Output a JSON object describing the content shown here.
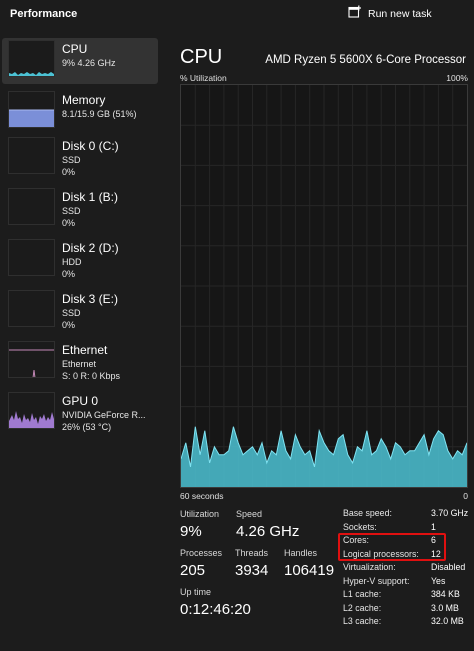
{
  "header": {
    "title": "Performance",
    "run_new_task_label": "Run new task"
  },
  "sidebar": {
    "items": [
      {
        "name": "CPU",
        "sub1": "9% 4.26 GHz",
        "sub2": "",
        "color": "#4cc2d4"
      },
      {
        "name": "Memory",
        "sub1": "8.1/15.9 GB (51%)",
        "sub2": "",
        "color": "#7b8fd8"
      },
      {
        "name": "Disk 0 (C:)",
        "sub1": "SSD",
        "sub2": "0%",
        "color": "#6ac26a"
      },
      {
        "name": "Disk 1 (B:)",
        "sub1": "SSD",
        "sub2": "0%",
        "color": "#6ac26a"
      },
      {
        "name": "Disk 2 (D:)",
        "sub1": "HDD",
        "sub2": "0%",
        "color": "#6ac26a"
      },
      {
        "name": "Disk 3 (E:)",
        "sub1": "SSD",
        "sub2": "0%",
        "color": "#6ac26a"
      },
      {
        "name": "Ethernet",
        "sub1": "Ethernet",
        "sub2": "S: 0 R: 0 Kbps",
        "color": "#c58ab8"
      },
      {
        "name": "GPU 0",
        "sub1": "NVIDIA GeForce R...",
        "sub2": "26% (53 °C)",
        "color": "#a07ad0"
      }
    ]
  },
  "main": {
    "title": "CPU",
    "processor": "AMD Ryzen 5 5600X 6-Core Processor",
    "graph_label": "% Utilization",
    "graph_max": "100%",
    "time_label": "60 seconds",
    "time_end": "0",
    "graph_color": "#4cc2d4"
  },
  "stats": {
    "utilization": {
      "label": "Utilization",
      "value": "9%"
    },
    "speed": {
      "label": "Speed",
      "value": "4.26 GHz"
    },
    "processes": {
      "label": "Processes",
      "value": "205"
    },
    "threads": {
      "label": "Threads",
      "value": "3934"
    },
    "handles": {
      "label": "Handles",
      "value": "106419"
    },
    "uptime": {
      "label": "Up time",
      "value": "0:12:46:20"
    }
  },
  "properties": [
    {
      "name": "Base speed:",
      "value": "3.70 GHz"
    },
    {
      "name": "Sockets:",
      "value": "1"
    },
    {
      "name": "Cores:",
      "value": "6"
    },
    {
      "name": "Logical processors:",
      "value": "12"
    },
    {
      "name": "Virtualization:",
      "value": "Disabled"
    },
    {
      "name": "Hyper-V support:",
      "value": "Yes"
    },
    {
      "name": "L1 cache:",
      "value": "384 KB"
    },
    {
      "name": "L2 cache:",
      "value": "3.0 MB"
    },
    {
      "name": "L3 cache:",
      "value": "32.0 MB"
    }
  ],
  "cpu_history_percent": [
    7,
    11,
    5,
    15,
    8,
    14,
    6,
    10,
    8,
    8,
    9,
    15,
    11,
    8,
    9,
    10,
    8,
    11,
    6,
    9,
    8,
    14,
    9,
    7,
    13,
    10,
    8,
    9,
    5,
    14,
    11,
    9,
    8,
    12,
    13,
    8,
    6,
    10,
    9,
    14,
    8,
    9,
    12,
    10,
    7,
    11,
    10,
    8,
    9,
    9,
    11,
    13,
    8,
    12,
    14,
    13,
    9,
    7,
    9,
    8,
    11
  ]
}
